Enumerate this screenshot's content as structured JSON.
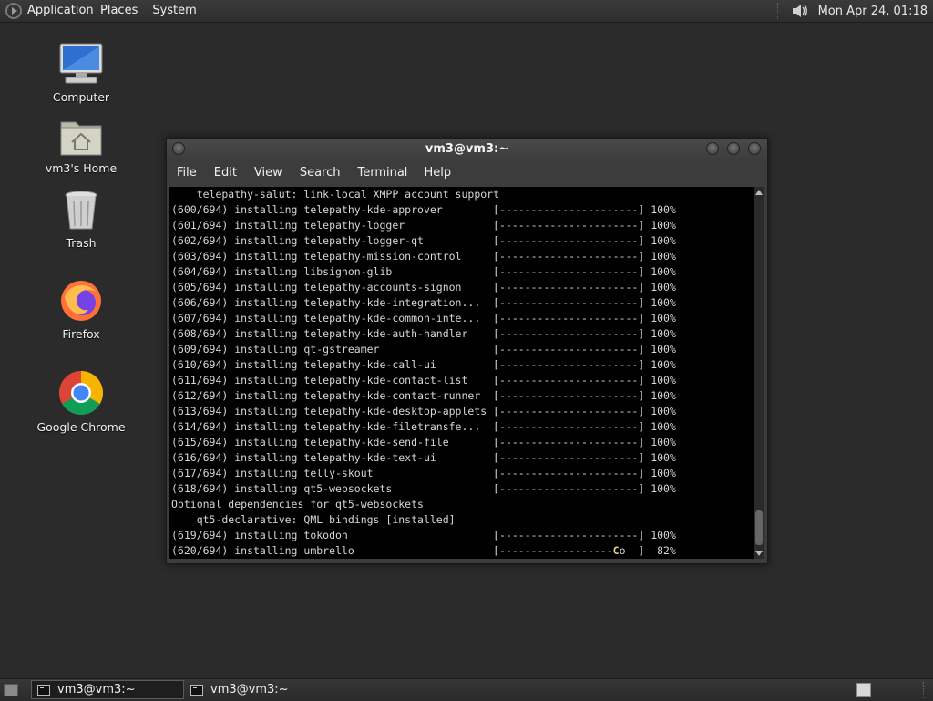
{
  "top_panel": {
    "menus": [
      "Applications",
      "Places",
      "System"
    ],
    "clock": "Mon Apr 24, 01:18"
  },
  "desktop_icons": [
    {
      "label": "Computer",
      "icon": "computer-icon"
    },
    {
      "label": "vm3's Home",
      "icon": "home-folder-icon"
    },
    {
      "label": "Trash",
      "icon": "trash-icon"
    },
    {
      "label": "Firefox",
      "icon": "firefox-icon"
    },
    {
      "label": "Google Chrome",
      "icon": "chrome-icon"
    }
  ],
  "terminal": {
    "title": "vm3@vm3:~",
    "menu": [
      "File",
      "Edit",
      "View",
      "Search",
      "Terminal",
      "Help"
    ],
    "lines": [
      "    telepathy-salut: link-local XMPP account support",
      "(600/694) installing telepathy-kde-approver        [----------------------] 100%",
      "(601/694) installing telepathy-logger              [----------------------] 100%",
      "(602/694) installing telepathy-logger-qt           [----------------------] 100%",
      "(603/694) installing telepathy-mission-control     [----------------------] 100%",
      "(604/694) installing libsignon-glib                [----------------------] 100%",
      "(605/694) installing telepathy-accounts-signon     [----------------------] 100%",
      "(606/694) installing telepathy-kde-integration...  [----------------------] 100%",
      "(607/694) installing telepathy-kde-common-inte...  [----------------------] 100%",
      "(608/694) installing telepathy-kde-auth-handler    [----------------------] 100%",
      "(609/694) installing qt-gstreamer                  [----------------------] 100%",
      "(610/694) installing telepathy-kde-call-ui         [----------------------] 100%",
      "(611/694) installing telepathy-kde-contact-list    [----------------------] 100%",
      "(612/694) installing telepathy-kde-contact-runner  [----------------------] 100%",
      "(613/694) installing telepathy-kde-desktop-applets [----------------------] 100%",
      "(614/694) installing telepathy-kde-filetransfe...  [----------------------] 100%",
      "(615/694) installing telepathy-kde-send-file       [----------------------] 100%",
      "(616/694) installing telepathy-kde-text-ui         [----------------------] 100%",
      "(617/694) installing telly-skout                   [----------------------] 100%",
      "(618/694) installing qt5-websockets                [----------------------] 100%",
      "Optional dependencies for qt5-websockets",
      "    qt5-declarative: QML bindings [installed]",
      "(619/694) installing tokodon                       [----------------------] 100%"
    ],
    "last_line_prefix": "(620/694) installing umbrello                      [------------------",
    "last_line_cursor": "C",
    "last_line_suffix": "o  ]  82%"
  },
  "taskbar": {
    "tasks": [
      "vm3@vm3:~",
      "vm3@vm3:~"
    ]
  },
  "colors": {
    "desktop_bg": "#2b2b2b",
    "terminal_bg": "#000000",
    "terminal_fg": "#d6d6d6",
    "cursor": "#e6d48a"
  }
}
